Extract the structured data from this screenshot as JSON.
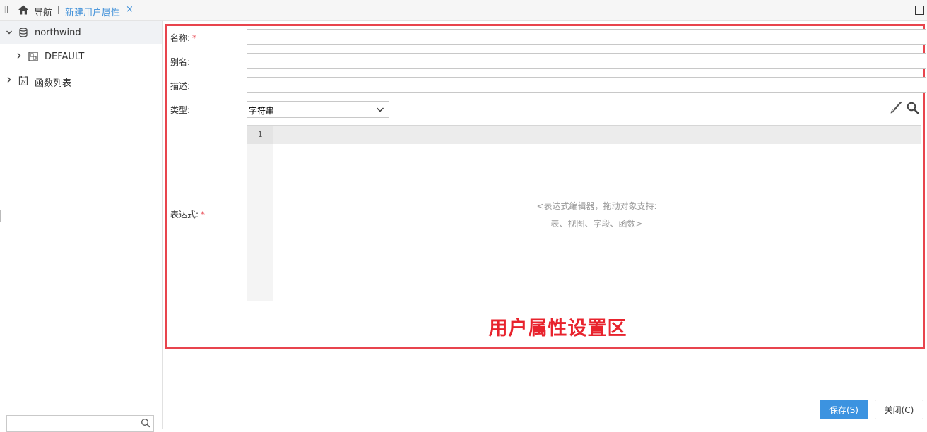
{
  "tabs": {
    "nav_label": "导航",
    "active_tab": "新建用户属性",
    "close_glyph": "×"
  },
  "sidebar": {
    "items": [
      {
        "label": "northwind",
        "icon": "database-icon",
        "expanded": true
      },
      {
        "label": "DEFAULT",
        "icon": "schema-icon",
        "expanded": false
      },
      {
        "label": "函数列表",
        "icon": "function-list-icon",
        "expanded": false
      }
    ],
    "search_placeholder": ""
  },
  "form": {
    "name_label": "名称:",
    "alias_label": "别名:",
    "desc_label": "描述:",
    "type_label": "类型:",
    "expr_label": "表达式:",
    "required_mark": "*",
    "name_value": "",
    "alias_value": "",
    "desc_value": "",
    "type_selected": "字符串",
    "editor": {
      "line_number": "1",
      "placeholder_line1": "<表达式编辑器，拖动对象支持:",
      "placeholder_line2": "表、视图、字段、函数>"
    }
  },
  "annotation": {
    "region_label": "用户属性设置区",
    "color": "#e8444d"
  },
  "buttons": {
    "save": "保存(S)",
    "close": "关闭(C)"
  },
  "colors": {
    "accent": "#3c93e0",
    "tab_active": "#3c8ed8",
    "required": "#e8444d"
  }
}
